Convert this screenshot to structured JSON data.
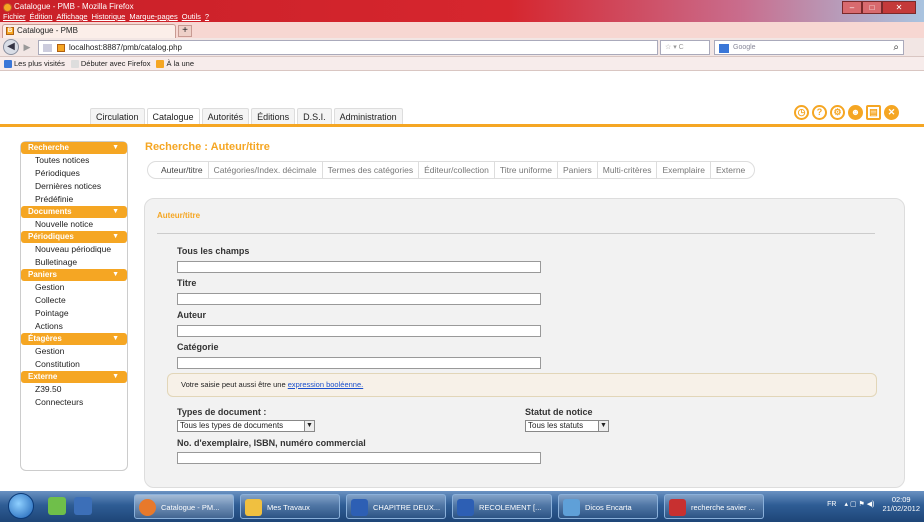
{
  "window": {
    "title": "Catalogue - PMB - Mozilla Firefox",
    "menu": [
      "Fichier",
      "Édition",
      "Affichage",
      "Historique",
      "Marque-pages",
      "Outils",
      "?"
    ]
  },
  "browser": {
    "tab_title": "Catalogue - PMB",
    "new_tab": "+",
    "url": "localhost:8887/pmb/catalog.php",
    "search_placeholder": "Google",
    "bookmarks": [
      "Les plus visités",
      "Débuter avec Firefox",
      "À la une"
    ]
  },
  "app": {
    "main_tabs": [
      "Circulation",
      "Catalogue",
      "Autorités",
      "Éditions",
      "D.S.I.",
      "Administration"
    ],
    "active_main_tab": "Catalogue",
    "accent_color": "#f5a623",
    "tool_icons": [
      "clock-icon",
      "help-icon",
      "settings-icon",
      "users-icon",
      "save-icon",
      "close-icon"
    ],
    "sidebar": [
      {
        "title": "Recherche",
        "items": [
          "Toutes notices",
          "Périodiques",
          "Dernières notices",
          "Prédéfinie"
        ]
      },
      {
        "title": "Documents",
        "items": [
          "Nouvelle notice"
        ]
      },
      {
        "title": "Périodiques",
        "items": [
          "Nouveau périodique",
          "Bulletinage"
        ]
      },
      {
        "title": "Paniers",
        "items": [
          "Gestion",
          "Collecte",
          "Pointage",
          "Actions"
        ]
      },
      {
        "title": "Étagères",
        "items": [
          "Gestion",
          "Constitution"
        ]
      },
      {
        "title": "Externe",
        "items": [
          "Z39.50",
          "Connecteurs"
        ]
      }
    ],
    "page_title": "Recherche : Auteur/titre",
    "sub_tabs": [
      "Auteur/titre",
      "Catégories/Index. décimale",
      "Termes des catégories",
      "Éditeur/collection",
      "Titre uniforme",
      "Paniers",
      "Multi-critères",
      "Exemplaire",
      "Externe"
    ],
    "active_sub_tab": "Auteur/titre",
    "form": {
      "title": "Auteur/titre",
      "label_all": "Tous les champs",
      "label_title": "Titre",
      "label_author": "Auteur",
      "label_category": "Catégorie",
      "hint_text": "Votre saisie peut aussi être une ",
      "hint_link": "expression booléenne.",
      "label_doc_types": "Types de document :",
      "doc_types_value": "Tous les types de documents",
      "label_status": "Statut de notice",
      "status_value": "Tous les statuts",
      "label_isbn": "No. d'exemplaire, ISBN, numéro commercial"
    }
  },
  "taskbar": {
    "items": [
      "Catalogue - PM...",
      "Mes Travaux",
      "CHAPITRE DEUX...",
      "RECOLEMENT [...",
      "Dicos Encarta",
      "recherche savier ..."
    ],
    "language": "FR",
    "time": "02:09",
    "date": "21/02/2012"
  }
}
